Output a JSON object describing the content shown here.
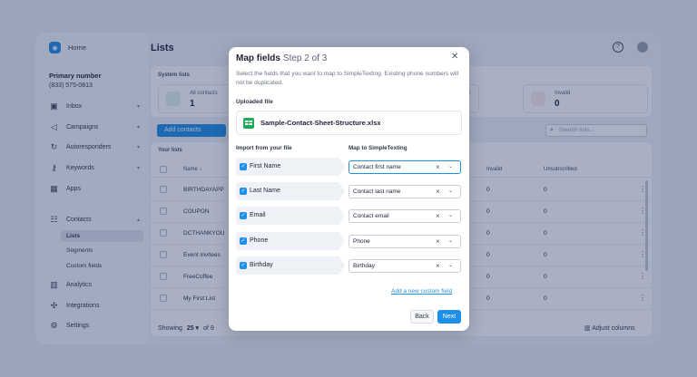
{
  "sidebar": {
    "home_label": "Home",
    "primary_label": "Primary number",
    "primary_number": "(833) 575-0813",
    "nav": [
      {
        "label": "Inbox",
        "icon": "inbox-icon"
      },
      {
        "label": "Campaigns",
        "icon": "megaphone-icon"
      },
      {
        "label": "Autoresponders",
        "icon": "autoresponder-icon"
      },
      {
        "label": "Keywords",
        "icon": "key-icon"
      },
      {
        "label": "Apps",
        "icon": "apps-icon"
      },
      {
        "label": "Contacts",
        "icon": "contacts-icon"
      },
      {
        "label": "Analytics",
        "icon": "analytics-icon"
      },
      {
        "label": "Integrations",
        "icon": "integrations-icon"
      },
      {
        "label": "Settings",
        "icon": "gear-icon"
      }
    ],
    "contacts_sub": [
      "Lists",
      "Segments",
      "Custom fields"
    ]
  },
  "main": {
    "title": "Lists",
    "system_lists_label": "System lists",
    "stats": [
      {
        "label": "All contacts",
        "value": "1"
      },
      {
        "label": "ed",
        "value": ""
      },
      {
        "label": "Invalid",
        "value": "0"
      }
    ],
    "add_contacts_label": "Add contacts",
    "search_placeholder": "Search lists...",
    "your_lists_label": "Your lists",
    "columns": {
      "name": "Name",
      "invalid": "Invalid",
      "unsubscribed": "Unsubscribed"
    },
    "rows": [
      {
        "name": "BIRTHDAYAPP",
        "invalid": "0",
        "unsubscribed": "0"
      },
      {
        "name": "COUPON",
        "invalid": "0",
        "unsubscribed": "0"
      },
      {
        "name": "DCTHANKYOU",
        "invalid": "0",
        "unsubscribed": "0"
      },
      {
        "name": "Event Invitees",
        "invalid": "0",
        "unsubscribed": "0"
      },
      {
        "name": "FreeCoffee",
        "invalid": "0",
        "unsubscribed": "0"
      },
      {
        "name": "My First List",
        "invalid": "0",
        "unsubscribed": "0"
      }
    ],
    "footer": {
      "showing": "Showing",
      "per_page": "25",
      "of": "of 9",
      "adjust": "Adjust columns"
    }
  },
  "modal": {
    "title": "Map fields",
    "step": "Step 2 of 3",
    "description": "Select the fields that you want to map to SimpleTexting. Existing phone numbers will not be duplicated.",
    "uploaded_label": "Uploaded file",
    "file_name": "Sample-Contact-Sheet-Structure.xlsx",
    "col_import": "Import from your file",
    "col_map": "Map to SimpleTexting",
    "mappings": [
      {
        "field": "First Name",
        "target": "Contact first name"
      },
      {
        "field": "Last Name",
        "target": "Contact last name"
      },
      {
        "field": "Email",
        "target": "Contact email"
      },
      {
        "field": "Phone",
        "target": "Phone"
      },
      {
        "field": "Birthday",
        "target": "Birthday"
      }
    ],
    "add_custom": "Add a new custom field",
    "back": "Back",
    "next": "Next"
  },
  "colors": {
    "accent": "#1e8fe6",
    "overlay": "#1c3062"
  }
}
